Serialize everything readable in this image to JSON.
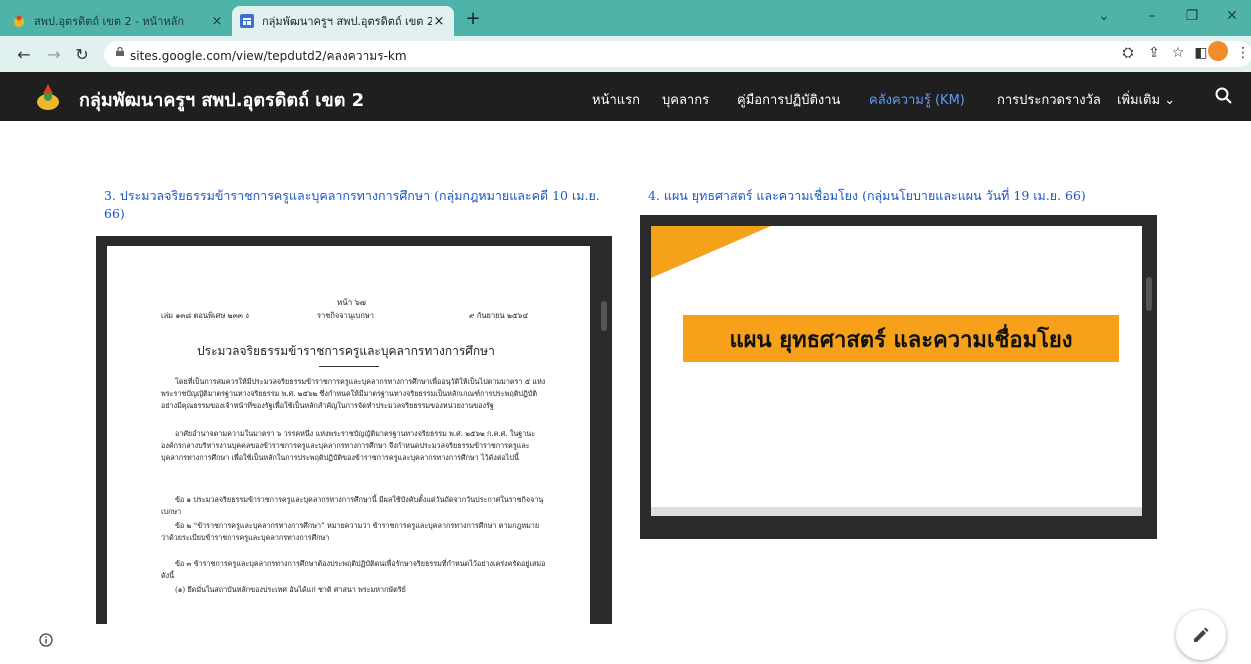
{
  "browser": {
    "tabs": [
      {
        "title": "สพป.อุตรดิตถ์ เขต 2 - หน้าหลัก",
        "active": false
      },
      {
        "title": "กลุ่มพัฒนาครูฯ สพป.อุตรดิตถ์ เขต 2 -",
        "active": true
      }
    ],
    "new_tab": "+",
    "close_glyph": "×",
    "url": "sites.google.com/view/tepdutd2/คลงความร-km",
    "icons": [
      "back-icon",
      "forward-icon",
      "reload-icon",
      "lock-icon",
      "translate-icon",
      "share-icon",
      "star-icon",
      "sidepanel-icon",
      "profile-avatar",
      "menu-icon"
    ]
  },
  "site": {
    "name": "กลุ่มพัฒนาครูฯ สพป.อุตรดิตถ์ เขต 2",
    "nav": [
      "หน้าแรก",
      "บุคลากร",
      "คู่มือการปฏิบัติงาน",
      "คลังความรู้ (KM)",
      "การประกวดรางวัล",
      "เพิ่มเติม"
    ],
    "current_nav": "คลังความรู้ (KM)",
    "accent": "#5e9cf8",
    "header_bg": "#1f1f1f"
  },
  "content": {
    "item1": {
      "caption_line1": "3. ประมวลจริยธรรมข้าราชการครูและบุคลากรทางการศึกษา (กลุ่มกฎหมายและคดี 10 เม.ย.",
      "caption_line2": "66)",
      "doc": {
        "page_no": "หน้า ๖๗",
        "header_left": "เล่ม ๑๓๘ ตอนพิเศษ ๒๓๓ ง",
        "header_mid": "ราชกิจจานุเบกษา",
        "header_right": "๙ กันยายน ๒๕๖๔",
        "title": "ประมวลจริยธรรมข้าราชการครูและบุคลากรทางการศึกษา",
        "paragraphs": [
          "โดยที่เป็นการสมควรให้มีประมวลจริยธรรมข้าราชการครูและบุคลากรทางการศึกษาเพื่ออนุวัติให้เป็นไปตามมาตรา ๕ แห่งพระราชบัญญัติมาตรฐานทางจริยธรรม พ.ศ. ๒๕๖๒ ซึ่งกำหนดให้มีมาตรฐานทางจริยธรรมเป็นหลักเกณฑ์การประพฤติปฏิบัติอย่างมีคุณธรรมของเจ้าหน้าที่ของรัฐเพื่อใช้เป็นหลักสำคัญในการจัดทำประมวลจริยธรรมของหน่วยงานของรัฐ",
          "อาศัยอำนาจตามความในมาตรา ๖ วรรคหนึ่ง แห่งพระราชบัญญัติมาตรฐานทางจริยธรรม พ.ศ. ๒๕๖๒ ก.ค.ศ. ในฐานะองค์กรกลางบริหารงานบุคคลของข้าราชการครูและบุคลากรทางการศึกษา จึงกำหนดประมวลจริยธรรมข้าราชการครูและบุคลากรทางการศึกษา เพื่อใช้เป็นหลักในการประพฤติปฏิบัติของข้าราชการครูและบุคลากรทางการศึกษา ไว้ดังต่อไปนี้",
          "ข้อ ๑ ประมวลจริยธรรมข้าราชการครูและบุคลากรทางการศึกษานี้ มีผลใช้บังคับตั้งแต่วันถัดจากวันประกาศในราชกิจจานุเบกษา",
          "ข้อ ๒ “ข้าราชการครูและบุคลากรทางการศึกษา” หมายความว่า ข้าราชการครูและบุคลากรทางการศึกษา ตามกฎหมายว่าด้วยระเบียบข้าราชการครูและบุคลากรทางการศึกษา",
          "ข้อ ๓ ข้าราชการครูและบุคลากรทางการศึกษาต้องประพฤติปฏิบัติตนเพื่อรักษาจริยธรรมที่กำหนดไว้อย่างเคร่งครัดอยู่เสมอ ดังนี้",
          "(๑) ยึดมั่นในสถาบันหลักของประเทศ อันได้แก่ ชาติ ศาสนา พระมหากษัตริย์"
        ]
      }
    },
    "item2": {
      "caption": "4. แผน ยุทธศาสตร์ และความเชื่อมโยง (กลุ่มนโยบายและแผน วันที่ 19 เม.ย. 66)",
      "slide_title": "แผน  ยุทธศาสตร์  และความเชื่อมโยง",
      "accent": "#f7a11b"
    }
  }
}
